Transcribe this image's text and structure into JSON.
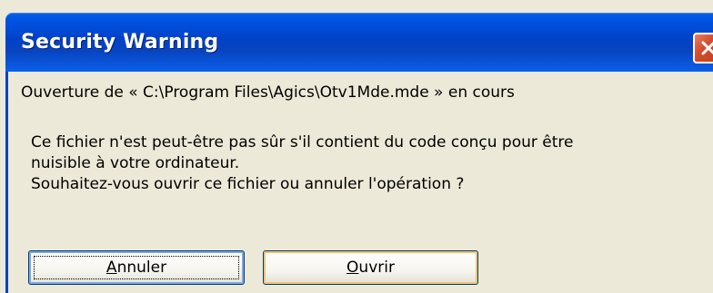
{
  "dialog": {
    "title": "Security Warning",
    "path_line": "Ouverture de « C:\\Program Files\\Agics\\Otv1Mde.mde » en cours",
    "message": "Ce fichier n'est peut-être pas sûr s'il contient du code conçu pour être\nnuisible à votre ordinateur.\nSouhaitez-vous ouvrir ce fichier ou annuler l'opération ?",
    "buttons": {
      "cancel_mnemonic": "A",
      "cancel_rest": "nnuler",
      "open_mnemonic": "O",
      "open_rest": "uvrir"
    },
    "close_icon": "close-icon"
  }
}
